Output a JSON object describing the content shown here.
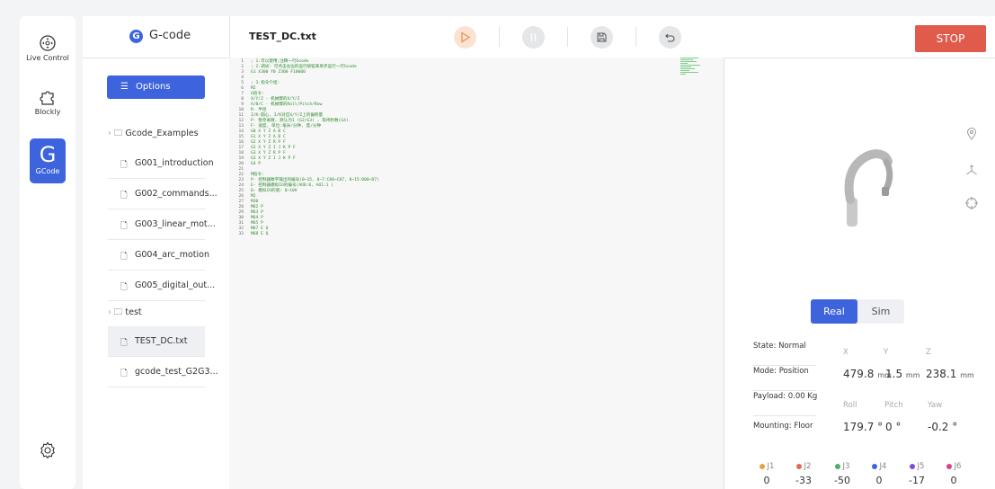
{
  "rail": {
    "items": [
      {
        "label": "Live Control",
        "icon": "joystick-icon"
      },
      {
        "label": "Blockly",
        "icon": "puzzle-icon"
      },
      {
        "label": "GCode",
        "glyph": "G",
        "icon": "gcode-icon"
      }
    ],
    "settings_icon": "gear-icon"
  },
  "header": {
    "app_name": "G-code",
    "logo_letter": "G",
    "file_title": "TEST_DC.txt",
    "stop_label": "STOP"
  },
  "sidebar": {
    "options_label": "Options",
    "folders": [
      {
        "label": "Gcode_Examples",
        "files": [
          "G001_introduction",
          "G002_commands...",
          "G003_linear_mot...",
          "G004_arc_motion",
          "G005_digital_out..."
        ]
      },
      {
        "label": "test",
        "files": [
          "TEST_DC.txt",
          "gcode_test_G2G3..."
        ]
      }
    ],
    "selected_file": "TEST_DC.txt"
  },
  "editor": {
    "lines": [
      "; 1.可以使用;注释一行Gcode",
      "; 2.调试: 可点击左边的运行按钮来单步运行一行Gcode",
      "G1 X300 Y0 Z300 F10000",
      "",
      "; 3.指令介绍:",
      "M2",
      "G指令:",
      "X/Y/Z - 机械臂的X/Y/Z",
      "A/B/C - 机械臂的Roll/Pitch/Row",
      "R- 半径",
      "I/K-圆心, I/K对应X/Y/Z上的偏移量",
      "P- 暂停离散, 默认为1 (G2/G3) , 等待秒数(G4)",
      "F- 速度, 单位:毫米/分钟, 度/分钟",
      "G0 X Y Z A B C",
      "G1 X Y Z A B C",
      "G2 X Y Z R P F",
      "G2 X Y Z I J K P F",
      "G3 X Y Z R P F",
      "G3 X Y Z I J K P F",
      "G4 P",
      "",
      "M指令:",
      "P- 控制器数字输出的编号(0~15, 0~7:C00~C07, 8~15:D00~D7)",
      "E- 控制器模拟IO的编号(AO0:0, AO1:1 )",
      "Q- 模拟IO的值: 0~10V",
      "M2",
      "M30",
      "M62 P",
      "M63 P",
      "M64 P",
      "M65 P",
      "M67 E Q",
      "M68 E Q"
    ]
  },
  "robot_view": {
    "mode_real": "Real",
    "mode_sim": "Sim",
    "active_mode": "Real"
  },
  "status": {
    "state": "State: Normal",
    "mode": "Mode: Position",
    "payload": "Payload: 0.00 Kg",
    "mounting": "Mounting: Floor"
  },
  "position": {
    "x_label": "X",
    "y_label": "Y",
    "z_label": "Z",
    "x": "479.8",
    "x_unit": "mm",
    "y": "1.5",
    "y_unit": "mm",
    "z": "238.1",
    "z_unit": "mm",
    "roll_label": "Roll",
    "pitch_label": "Pitch",
    "yaw_label": "Yaw",
    "roll": "179.7 °",
    "pitch": "0 °",
    "yaw": "-0.2 °"
  },
  "joints": [
    {
      "label": "J1",
      "value": "0",
      "color": "#e3a33f"
    },
    {
      "label": "J2",
      "value": "-33",
      "color": "#e06a5b"
    },
    {
      "label": "J3",
      "value": "-50",
      "color": "#4caf6a"
    },
    {
      "label": "J4",
      "value": "0",
      "color": "#3d63dd"
    },
    {
      "label": "J5",
      "value": "-17",
      "color": "#7c4dd8"
    },
    {
      "label": "J6",
      "value": "0",
      "color": "#d8408e"
    }
  ],
  "colors": {
    "accent": "#3d63dd",
    "stop": "#e05b4b",
    "code": "#2e8b2e"
  }
}
